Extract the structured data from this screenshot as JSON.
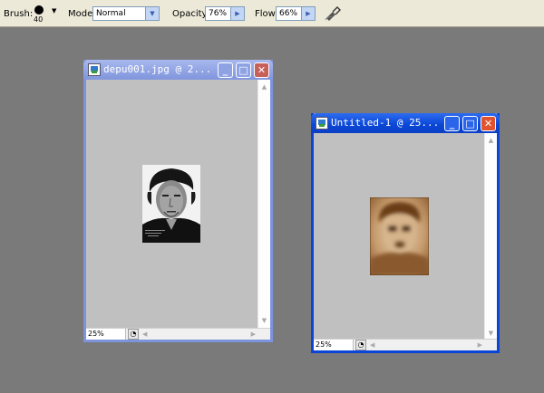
{
  "options_bar": {
    "brush_label": "Brush:",
    "brush_size": "40",
    "mode_label": "Mode:",
    "mode_value": "Normal",
    "opacity_label": "Opacity:",
    "opacity_value": "76%",
    "flow_label": "Flow:",
    "flow_value": "66%",
    "airbrush_icon": "airbrush-icon"
  },
  "windows": [
    {
      "title": "depu001.jpg @ 2...",
      "zoom": "25%",
      "state": "inactive",
      "content": "grayscale portrait photo"
    },
    {
      "title": "Untitled-1 @ 25...",
      "zoom": "25%",
      "state": "active",
      "content": "sepia blurred portrait"
    }
  ],
  "colors": {
    "workspace": "#7a7a7a",
    "canvas_bg": "#c0c0c0",
    "active_title": "#0a46d6",
    "inactive_title": "#8095dc"
  }
}
